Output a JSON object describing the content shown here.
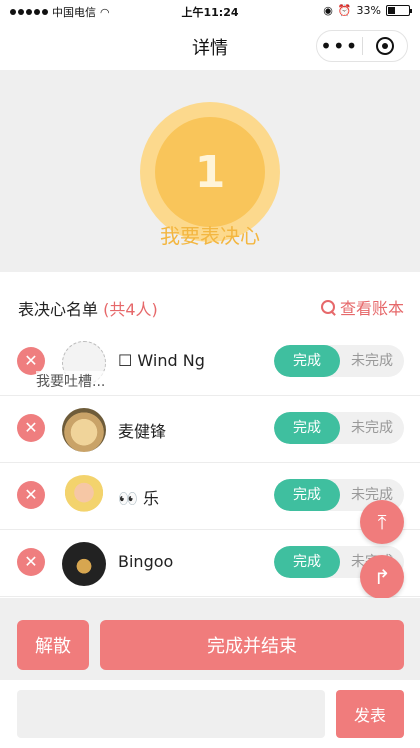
{
  "status_bar": {
    "carrier": "中国电信",
    "time": "上午11:24",
    "battery": "33%"
  },
  "navbar": {
    "title": "详情",
    "more_label": "•••"
  },
  "hero": {
    "badge_number": "1",
    "pledge_label": "我要表决心"
  },
  "list": {
    "title": "表决心名单",
    "count": "(共4人)",
    "ledger_label": "查看账本",
    "members": [
      {
        "name": "☐ Wind Ng",
        "subtext": "我要吐槽...",
        "avatar": "house-avatar",
        "done_label": "完成",
        "undone_label": "未完成"
      },
      {
        "name": "麦健锋",
        "avatar": "cat-avatar",
        "done_label": "完成",
        "undone_label": "未完成"
      },
      {
        "name": "👀 乐",
        "avatar": "girl-avatar",
        "done_label": "完成",
        "undone_label": "未完成"
      },
      {
        "name": "Bingoo",
        "avatar": "car-avatar",
        "done_label": "完成",
        "undone_label": "未完成"
      }
    ]
  },
  "actions": {
    "dissolve_label": "解散",
    "finish_label": "完成并结束"
  },
  "compose": {
    "placeholder": "",
    "post_label": "发表"
  },
  "fabs": {
    "top_icon": "arrow-up-to-top-icon",
    "share_icon": "share-arrow-icon",
    "home_icon": "home-icon"
  },
  "colors": {
    "accent": "#f07c7c",
    "done_green": "#3fbf9f",
    "gold": "#f9c55a"
  }
}
